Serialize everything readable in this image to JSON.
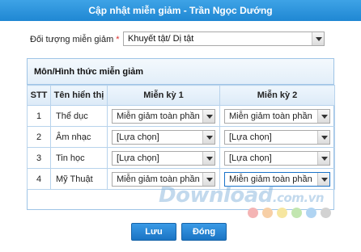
{
  "window": {
    "title": "Cập nhật miễn giảm - Trần Ngọc Dướng"
  },
  "form": {
    "subject_label": "Đối tượng miễn giảm",
    "required_mark": "*",
    "subject_value": "Khuyết tật/ Dị tật"
  },
  "panel": {
    "title": "Môn/Hình thức miễn giảm",
    "columns": [
      "STT",
      "Tên hiển thị",
      "Miễn kỳ 1",
      "Miễn kỳ 2"
    ],
    "rows": [
      {
        "stt": "1",
        "name": "Thể dục",
        "ky1": "Miễn giảm toàn phần",
        "ky2": "Miễn giảm toàn phần"
      },
      {
        "stt": "2",
        "name": "Âm nhạc",
        "ky1": "[Lựa chọn]",
        "ky2": "[Lựa chọn]"
      },
      {
        "stt": "3",
        "name": "Tin học",
        "ky1": "[Lựa chọn]",
        "ky2": "[Lựa chọn]"
      },
      {
        "stt": "4",
        "name": "Mỹ Thuật",
        "ky1": "Miễn giảm toàn phần",
        "ky2": "Miễn giảm toàn phần"
      }
    ]
  },
  "buttons": {
    "save": "Lưu",
    "close": "Đóng"
  },
  "watermark": {
    "main": "Download",
    "domain": ".com.vn"
  },
  "colors": {
    "titlebar": "#1f87d3",
    "button": "#1a74c4",
    "dots": [
      "#f4a6a6",
      "#f7c59a",
      "#f7e79a",
      "#b9e3a6",
      "#a6cff0",
      "#c9c9c9"
    ]
  }
}
